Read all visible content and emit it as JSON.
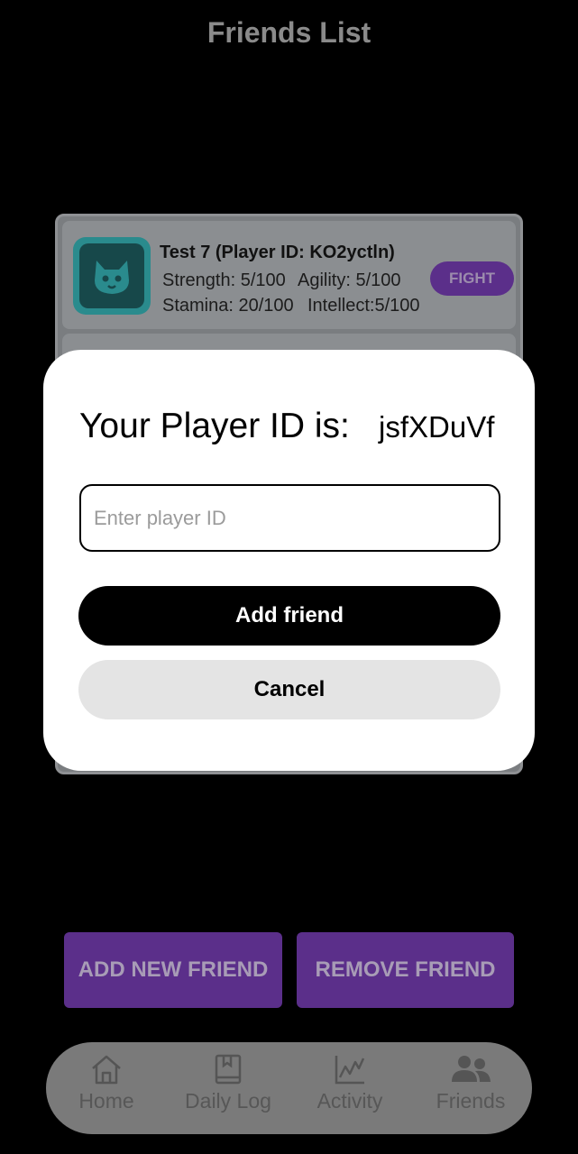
{
  "header": {
    "title": "Friends List"
  },
  "friends": [
    {
      "name": "Test 7 (Player ID: KO2yctln)",
      "strength": "Strength: 5/100",
      "agility": "Agility: 5/100",
      "stamina": "Stamina: 20/100",
      "intellect": "Intellect:5/100",
      "fight_label": "FIGHT"
    }
  ],
  "modal": {
    "label": "Your Player ID is:",
    "player_id": "jsfXDuVf",
    "input_placeholder": "Enter player ID",
    "input_value": "",
    "add_label": "Add friend",
    "cancel_label": "Cancel"
  },
  "actions": {
    "add_new_friend": "ADD NEW FRIEND",
    "remove_friend": "REMOVE FRIEND"
  },
  "nav": {
    "items": [
      {
        "label": "Home",
        "icon": "home-icon"
      },
      {
        "label": "Daily Log",
        "icon": "book-icon"
      },
      {
        "label": "Activity",
        "icon": "chart-icon"
      },
      {
        "label": "Friends",
        "icon": "people-icon"
      }
    ],
    "active": "Friends"
  },
  "colors": {
    "accent_purple": "#5b2f8a",
    "background": "#000000",
    "avatar_teal": "#2a8b8d"
  }
}
